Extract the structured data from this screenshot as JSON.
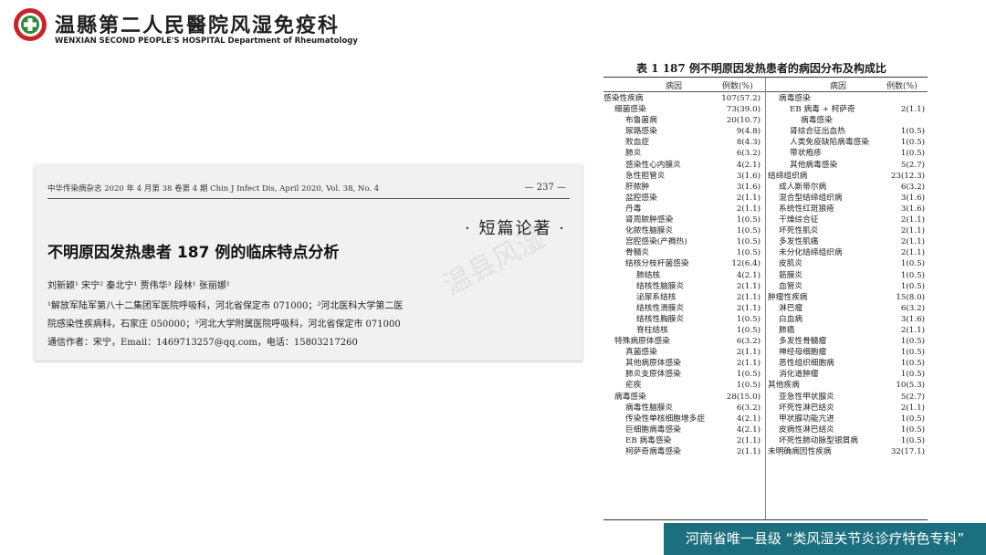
{
  "header": {
    "hospital_cn": "温縣第二人民醫院风湿免疫科",
    "hospital_en": "WENXIAN SECOND PEOPLE'S HOSPITAL Department of Rheumatology"
  },
  "paper": {
    "journal_line": "中华传染病杂志 2020 年 4 月第 38 卷第 4 期   Chin J Infect Dis, April 2020, Vol. 38, No. 4",
    "page_number": "— 237 —",
    "section": "· 短篇论著 ·",
    "title": "不明原因发热患者 187 例的临床特点分析",
    "authors": "刘新颖¹  宋宁²  秦北宁¹  贾伟华³  段林¹  张丽娜¹",
    "affiliation_1": "¹解放军陆军第八十二集团军医院呼吸科，河北省保定市   071000；²河北医科大学第二医",
    "affiliation_2": "院感染性疾病科，石家庄   050000；³河北大学附属医院呼吸科，河北省保定市   071000",
    "correspondence": "通信作者：宋宁，Email：1469713257@qq.com，电话：15803217260"
  },
  "watermark": "温县风湿",
  "table": {
    "title": "表 1   187 例不明原因发热患者的病因分布及构成比",
    "col_name": "病因",
    "col_value": "例数(%)",
    "left_rows": [
      {
        "name": "感染性疾病",
        "value": "107(57.2)",
        "indent": 0
      },
      {
        "name": "细菌感染",
        "value": "73(39.0)",
        "indent": 1
      },
      {
        "name": "布鲁菌病",
        "value": "20(10.7)",
        "indent": 2
      },
      {
        "name": "尿路感染",
        "value": "9(4.8)",
        "indent": 2
      },
      {
        "name": "败血症",
        "value": "8(4.3)",
        "indent": 2
      },
      {
        "name": "肺炎",
        "value": "6(3.2)",
        "indent": 2
      },
      {
        "name": "感染性心内膜炎",
        "value": "4(2.1)",
        "indent": 2
      },
      {
        "name": "急性胆管炎",
        "value": "3(1.6)",
        "indent": 2
      },
      {
        "name": "肝脓肿",
        "value": "3(1.6)",
        "indent": 2
      },
      {
        "name": "盆腔感染",
        "value": "2(1.1)",
        "indent": 2
      },
      {
        "name": "丹毒",
        "value": "2(1.1)",
        "indent": 2
      },
      {
        "name": "肾周脓肿感染",
        "value": "1(0.5)",
        "indent": 2
      },
      {
        "name": "化脓性脑膜炎",
        "value": "1(0.5)",
        "indent": 2
      },
      {
        "name": "宫腔感染(产褥热)",
        "value": "1(0.5)",
        "indent": 2
      },
      {
        "name": "骨髓炎",
        "value": "1(0.5)",
        "indent": 2
      },
      {
        "name": "结核分枝杆菌感染",
        "value": "12(6.4)",
        "indent": 2
      },
      {
        "name": "肺结核",
        "value": "4(2.1)",
        "indent": 3
      },
      {
        "name": "结核性脑膜炎",
        "value": "2(1.1)",
        "indent": 3
      },
      {
        "name": "泌尿系结核",
        "value": "2(1.1)",
        "indent": 3
      },
      {
        "name": "结核性滑膜炎",
        "value": "2(1.1)",
        "indent": 3
      },
      {
        "name": "结核性胸膜炎",
        "value": "1(0.5)",
        "indent": 3
      },
      {
        "name": "脊柱结核",
        "value": "1(0.5)",
        "indent": 3
      },
      {
        "name": "特殊病原体感染",
        "value": "6(3.2)",
        "indent": 1
      },
      {
        "name": "真菌感染",
        "value": "2(1.1)",
        "indent": 2
      },
      {
        "name": "其他病原体感染",
        "value": "2(1.1)",
        "indent": 2
      },
      {
        "name": "肺炎支原体感染",
        "value": "1(0.5)",
        "indent": 2
      },
      {
        "name": "疟疾",
        "value": "1(0.5)",
        "indent": 2
      },
      {
        "name": "病毒感染",
        "value": "28(15.0)",
        "indent": 1
      },
      {
        "name": "病毒性脑膜炎",
        "value": "6(3.2)",
        "indent": 2
      },
      {
        "name": "传染性单核细胞增多症",
        "value": "4(2.1)",
        "indent": 2
      },
      {
        "name": "巨细胞病毒感染",
        "value": "4(2.1)",
        "indent": 2
      },
      {
        "name": "EB 病毒感染",
        "value": "2(1.1)",
        "indent": 2
      },
      {
        "name": "柯萨奇病毒感染",
        "value": "2(1.1)",
        "indent": 2
      }
    ],
    "right_rows": [
      {
        "name": "病毒感染",
        "value": "",
        "indent": 1
      },
      {
        "name": "EB 病毒 + 柯萨奇",
        "value": "2(1.1)",
        "indent": 2
      },
      {
        "name": "病毒感染",
        "value": "",
        "indent": 3
      },
      {
        "name": "肾综合征出血热",
        "value": "1(0.5)",
        "indent": 2
      },
      {
        "name": "人类免疫缺陷病毒感染",
        "value": "1(0.5)",
        "indent": 2
      },
      {
        "name": "带状疱疹",
        "value": "1(0.5)",
        "indent": 2
      },
      {
        "name": "其他病毒感染",
        "value": "5(2.7)",
        "indent": 2
      },
      {
        "name": "结缔组织病",
        "value": "23(12.3)",
        "indent": 0
      },
      {
        "name": "成人斯蒂尔病",
        "value": "6(3.2)",
        "indent": 1
      },
      {
        "name": "混合型结缔组织病",
        "value": "3(1.6)",
        "indent": 1
      },
      {
        "name": "系统性红斑狼疮",
        "value": "3(1.6)",
        "indent": 1
      },
      {
        "name": "干燥综合征",
        "value": "2(1.1)",
        "indent": 1
      },
      {
        "name": "坏死性肌炎",
        "value": "2(1.1)",
        "indent": 1
      },
      {
        "name": "多发性肌痛",
        "value": "2(1.1)",
        "indent": 1
      },
      {
        "name": "未分化结缔组织病",
        "value": "2(1.1)",
        "indent": 1
      },
      {
        "name": "皮肌炎",
        "value": "1(0.5)",
        "indent": 1
      },
      {
        "name": "筋膜炎",
        "value": "1(0.5)",
        "indent": 1
      },
      {
        "name": "血管炎",
        "value": "1(0.5)",
        "indent": 1
      },
      {
        "name": "肿瘤性疾病",
        "value": "15(8.0)",
        "indent": 0
      },
      {
        "name": "淋巴瘤",
        "value": "6(3.2)",
        "indent": 1
      },
      {
        "name": "白血病",
        "value": "3(1.6)",
        "indent": 1
      },
      {
        "name": "肺癌",
        "value": "2(1.1)",
        "indent": 1
      },
      {
        "name": "多发性骨髓瘤",
        "value": "1(0.5)",
        "indent": 1
      },
      {
        "name": "神经母细胞瘤",
        "value": "1(0.5)",
        "indent": 1
      },
      {
        "name": "恶性组织细胞病",
        "value": "1(0.5)",
        "indent": 1
      },
      {
        "name": "消化道肿瘤",
        "value": "1(0.5)",
        "indent": 1
      },
      {
        "name": "其他疾病",
        "value": "10(5.3)",
        "indent": 0
      },
      {
        "name": "亚急性甲状腺炎",
        "value": "5(2.7)",
        "indent": 1
      },
      {
        "name": "坏死性淋巴结炎",
        "value": "2(1.1)",
        "indent": 1
      },
      {
        "name": "甲状腺功能亢进",
        "value": "1(0.5)",
        "indent": 1
      },
      {
        "name": "皮病性淋巴结炎",
        "value": "1(0.5)",
        "indent": 1
      },
      {
        "name": "坏死性肺动脉型银屑病",
        "value": "1(0.5)",
        "indent": 1
      },
      {
        "name": "未明确病因性疾病",
        "value": "32(17.1)",
        "indent": 0
      }
    ]
  },
  "banner": "河南省唯一县级 “类风湿关节炎诊疗特色专科”",
  "colors": {
    "banner": "#1b6f7f",
    "paper_bg": "#f1f1f1",
    "logo_red": "#c8252b",
    "logo_green": "#2e8b3e"
  }
}
